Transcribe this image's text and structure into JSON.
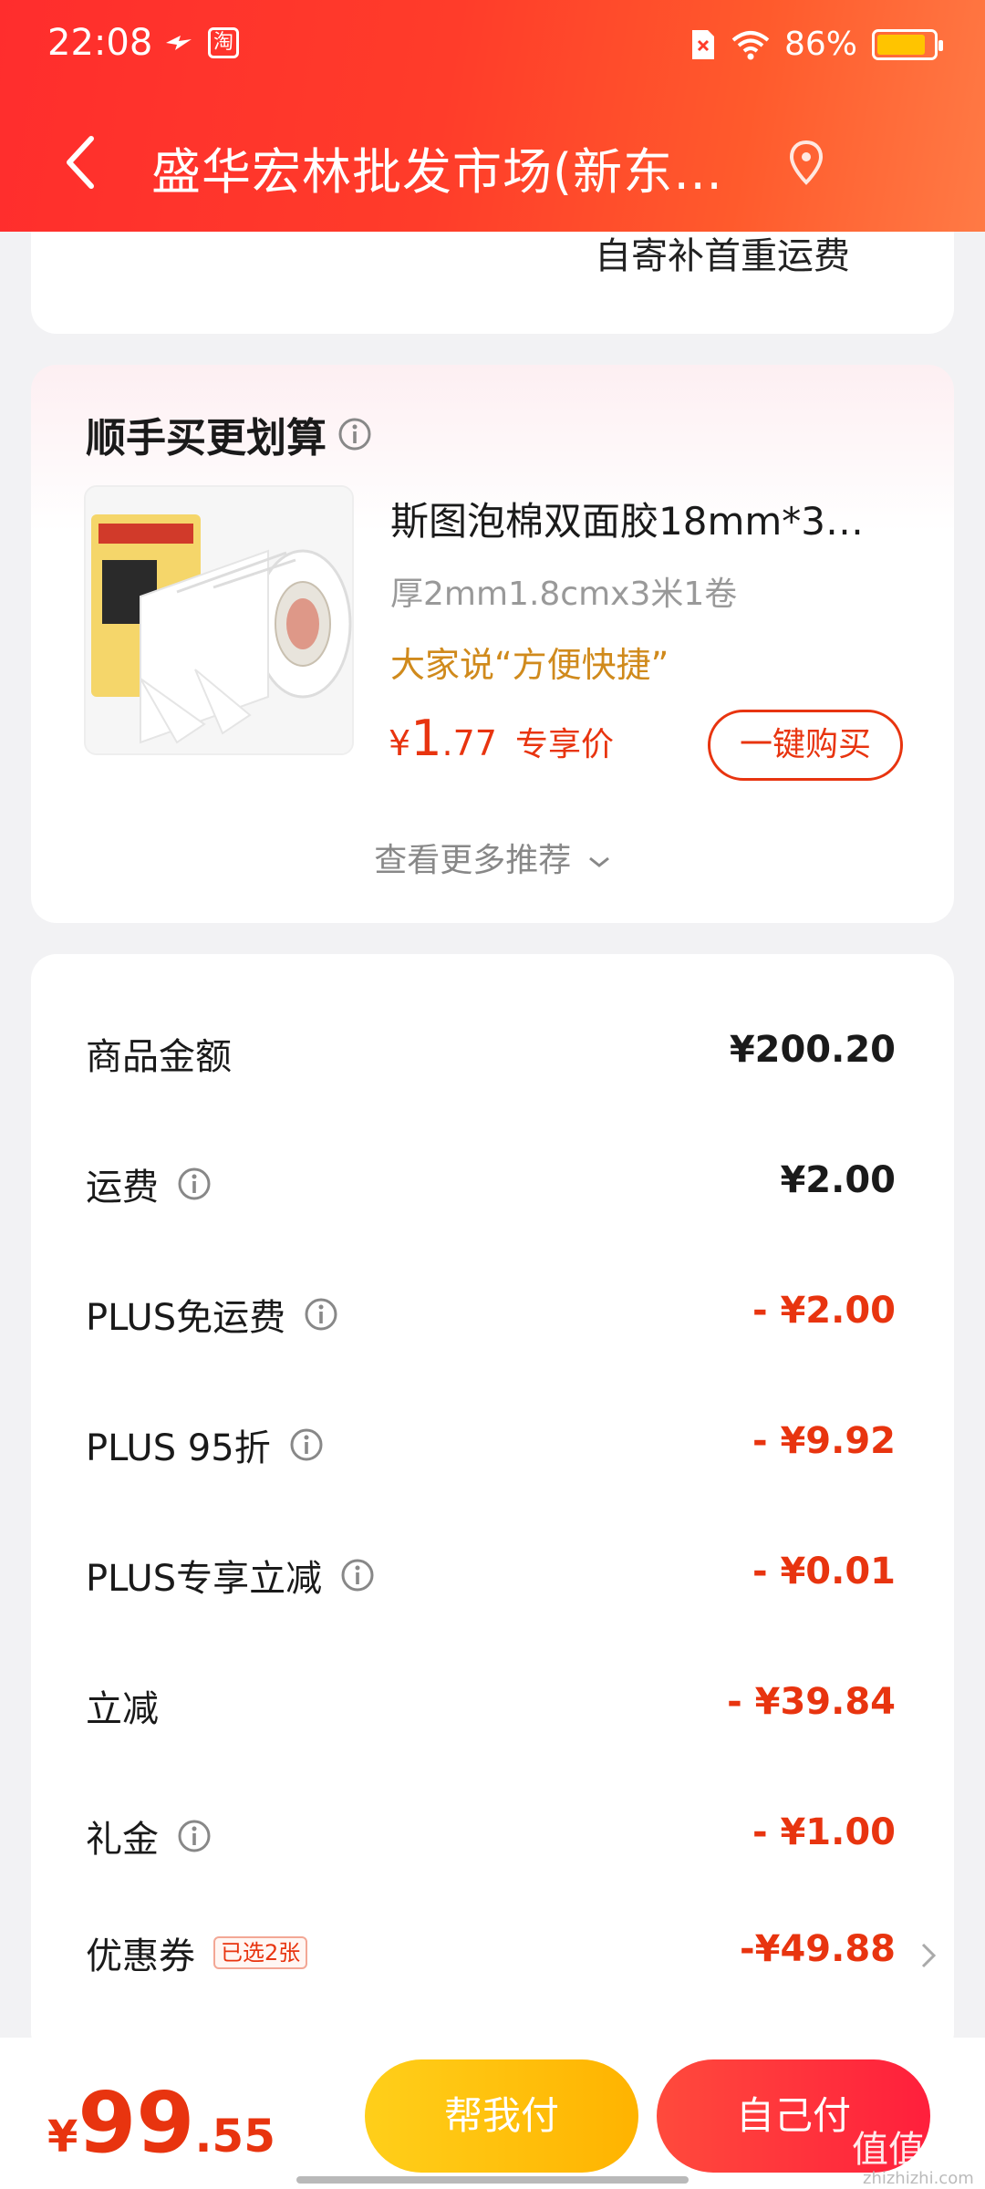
{
  "status_bar": {
    "time": "22:08",
    "app_badge": "淘",
    "battery_pct": "86%",
    "battery_level": 0.86
  },
  "nav": {
    "title": "盛华宏林批发市场(新东…"
  },
  "shipping": {
    "note": "自寄补首重运费"
  },
  "recommend": {
    "title": "顺手买更划算",
    "product": {
      "name": "斯图泡棉双面胶18mm*3…",
      "spec": "厚2mm1.8cmx3米1卷",
      "comment": "大家说“方便快捷”",
      "price_currency": "¥",
      "price_int": "1",
      "price_dec": ".77",
      "price_tag": "专享价",
      "buy_label": "一键购买"
    },
    "more_label": "查看更多推荐"
  },
  "summary": {
    "rows": [
      {
        "label": "商品金额",
        "value": "¥200.20"
      },
      {
        "label": "运费",
        "value": "¥2.00"
      },
      {
        "label": "PLUS免运费",
        "value": "- ¥2.00"
      },
      {
        "label": "PLUS 95折",
        "value": "- ¥9.92"
      },
      {
        "label": "PLUS专享立减",
        "value": "- ¥0.01"
      },
      {
        "label": "立减",
        "value": "- ¥39.84"
      },
      {
        "label": "礼金",
        "value": "- ¥1.00"
      },
      {
        "label": "优惠券",
        "value": "-¥49.88",
        "tag": "已选2张"
      }
    ]
  },
  "bottom": {
    "currency": "¥",
    "total_int": "99",
    "total_dec": ".55",
    "help_pay_label": "帮我付",
    "self_pay_label": "自己付"
  },
  "watermark": {
    "text": "值值值",
    "sub": "zhizhizhi.com"
  },
  "colors": {
    "accent": "#e8340f",
    "header": "#ff3c2a",
    "help_btn": "#ffb300",
    "self_btn": "#ff1f3c"
  }
}
